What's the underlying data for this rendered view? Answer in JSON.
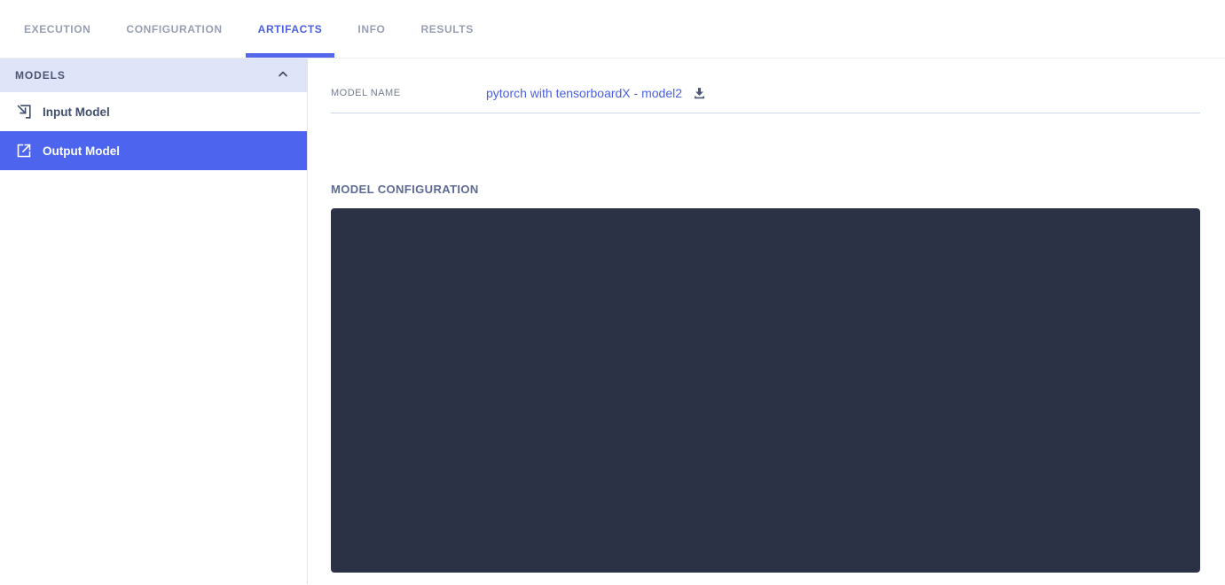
{
  "tabs": [
    {
      "label": "EXECUTION",
      "active": false
    },
    {
      "label": "CONFIGURATION",
      "active": false
    },
    {
      "label": "ARTIFACTS",
      "active": true
    },
    {
      "label": "INFO",
      "active": false
    },
    {
      "label": "RESULTS",
      "active": false
    }
  ],
  "sidebar": {
    "section_title": "MODELS",
    "collapse_icon": "chevron-up-icon",
    "items": [
      {
        "label": "Input Model",
        "icon": "input-model-icon",
        "selected": false
      },
      {
        "label": "Output Model",
        "icon": "output-model-icon",
        "selected": true
      }
    ]
  },
  "main": {
    "model_name_label": "MODEL NAME",
    "model_name_value": "pytorch with tensorboardX - model2",
    "download_icon": "download-icon",
    "configuration_title": "MODEL CONFIGURATION",
    "configuration_content": ""
  },
  "colors": {
    "active_tab_blue": "#4a5fe4",
    "tab_underline": "#5468eb",
    "inactive_tab_gray": "#989fb3",
    "selected_item_bg": "#4c64ee",
    "section_header_bg": "#e0e4f8",
    "dark_panel_bg": "#2c3246",
    "link_blue": "#4a5fe4",
    "divider_periwinkle": "#ccd6ec"
  }
}
